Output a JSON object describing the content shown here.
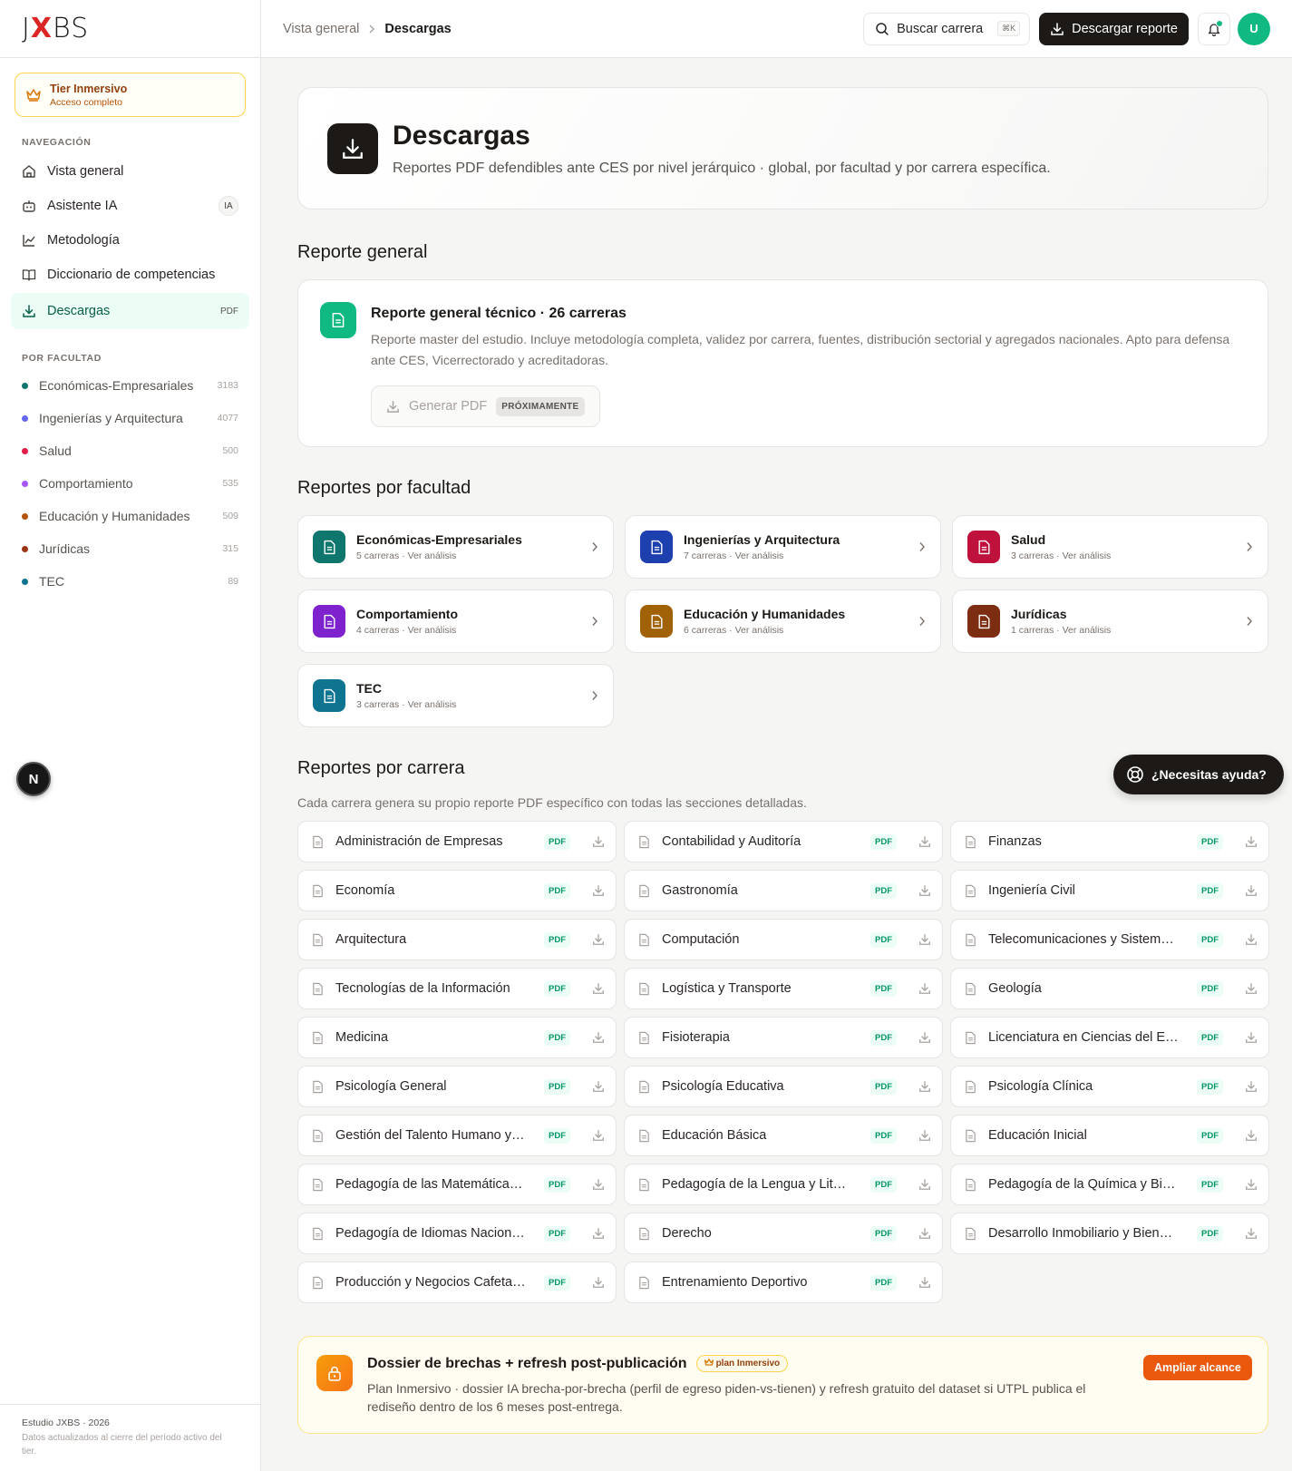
{
  "brand": {
    "logo_left": "J",
    "logo_x": "X",
    "logo_right": "BS"
  },
  "tier": {
    "title": "Tier Inmersivo",
    "subtitle": "Acceso completo"
  },
  "nav": {
    "section_label": "NAVEGACIÓN",
    "items": [
      {
        "label": "Vista general",
        "icon": "home-icon"
      },
      {
        "label": "Asistente IA",
        "icon": "bot-icon",
        "badge": "IA"
      },
      {
        "label": "Metodología",
        "icon": "chart-line-icon"
      },
      {
        "label": "Diccionario de competencias",
        "icon": "book-icon"
      },
      {
        "label": "Descargas",
        "icon": "download-icon",
        "badge": "PDF"
      }
    ]
  },
  "faculties_nav": {
    "section_label": "POR FACULTAD",
    "items": [
      {
        "label": "Económicas-Empresariales",
        "count": "3183",
        "color": "#0f766e"
      },
      {
        "label": "Ingenierías y Arquitectura",
        "count": "4077",
        "color": "#6366f1"
      },
      {
        "label": "Salud",
        "count": "500",
        "color": "#e11d48"
      },
      {
        "label": "Comportamiento",
        "count": "535",
        "color": "#a855f7"
      },
      {
        "label": "Educación y Humanidades",
        "count": "509",
        "color": "#b45309"
      },
      {
        "label": "Jurídicas",
        "count": "315",
        "color": "#9a3412"
      },
      {
        "label": "TEC",
        "count": "89",
        "color": "#0e7490"
      }
    ]
  },
  "sidebar_footer": {
    "title": "Estudio JXBS · 2026",
    "subtitle": "Datos actualizados al cierre del período activo del tier."
  },
  "floating_n": "N",
  "topbar": {
    "breadcrumb": [
      "Vista general",
      "Descargas"
    ],
    "search_label": "Buscar carrera",
    "search_kbd": "⌘K",
    "download_label": "Descargar reporte",
    "avatar_initial": "U"
  },
  "hero": {
    "title": "Descargas",
    "subtitle": "Reportes PDF defendibles ante CES por nivel jerárquico · global, por facultad y por carrera específica."
  },
  "general": {
    "section_title": "Reporte general",
    "card_title": "Reporte general técnico · 26 carreras",
    "card_desc": "Reporte master del estudio. Incluye metodología completa, validez por carrera, fuentes, distribución sectorial y agregados nacionales. Apto para defensa ante CES, Vicerrectorado y acreditadoras.",
    "button_label": "Generar PDF",
    "button_tag": "PRÓXIMAMENTE"
  },
  "faculty_reports": {
    "section_title": "Reportes por facultad",
    "items": [
      {
        "name": "Económicas-Empresariales",
        "meta": "5 carreras · Ver análisis",
        "color": "#0f766e"
      },
      {
        "name": "Ingenierías y Arquitectura",
        "meta": "7 carreras · Ver análisis",
        "color": "#1e40af"
      },
      {
        "name": "Salud",
        "meta": "3 carreras · Ver análisis",
        "color": "#be123c"
      },
      {
        "name": "Comportamiento",
        "meta": "4 carreras · Ver análisis",
        "color": "#7e22ce"
      },
      {
        "name": "Educación y Humanidades",
        "meta": "6 carreras · Ver análisis",
        "color": "#a16207"
      },
      {
        "name": "Jurídicas",
        "meta": "1 carreras · Ver análisis",
        "color": "#7c2d12"
      },
      {
        "name": "TEC",
        "meta": "3 carreras · Ver análisis",
        "color": "#0e7490"
      }
    ]
  },
  "career_reports": {
    "section_title": "Reportes por carrera",
    "description": "Cada carrera genera su propio reporte PDF específico con todas las secciones detalladas.",
    "pdf_tag": "PDF",
    "items": [
      "Administración de Empresas",
      "Contabilidad y Auditoría",
      "Finanzas",
      "Economía",
      "Gastronomía",
      "Ingeniería Civil",
      "Arquitectura",
      "Computación",
      "Telecomunicaciones y Sistemas ...",
      "Tecnologías de la Información",
      "Logística y Transporte",
      "Geología",
      "Medicina",
      "Fisioterapia",
      "Licenciatura en Ciencias del Ejer...",
      "Psicología General",
      "Psicología Educativa",
      "Psicología Clínica",
      "Gestión del Talento Humano y Bi...",
      "Educación Básica",
      "Educación Inicial",
      "Pedagogía de las Matemáticas y ...",
      "Pedagogía de la Lengua y Literat...",
      "Pedagogía de la Química y Biolo...",
      "Pedagogía de Idiomas Nacionale...",
      "Derecho",
      "Desarrollo Inmobiliario y Bienes ...",
      "Producción y Negocios Cafetaler...",
      "Entrenamiento Deportivo"
    ]
  },
  "dossier": {
    "title": "Dossier de brechas + refresh post-publicación",
    "tag": "plan Inmersivo",
    "desc": "Plan Inmersivo · dossier IA brecha-por-brecha (perfil de egreso piden-vs-tienen) y refresh gratuito del dataset si UTPL publica el rediseño dentro de los 6 meses post-entrega.",
    "button": "Ampliar alcance"
  },
  "help_button": "¿Necesitas ayuda?"
}
